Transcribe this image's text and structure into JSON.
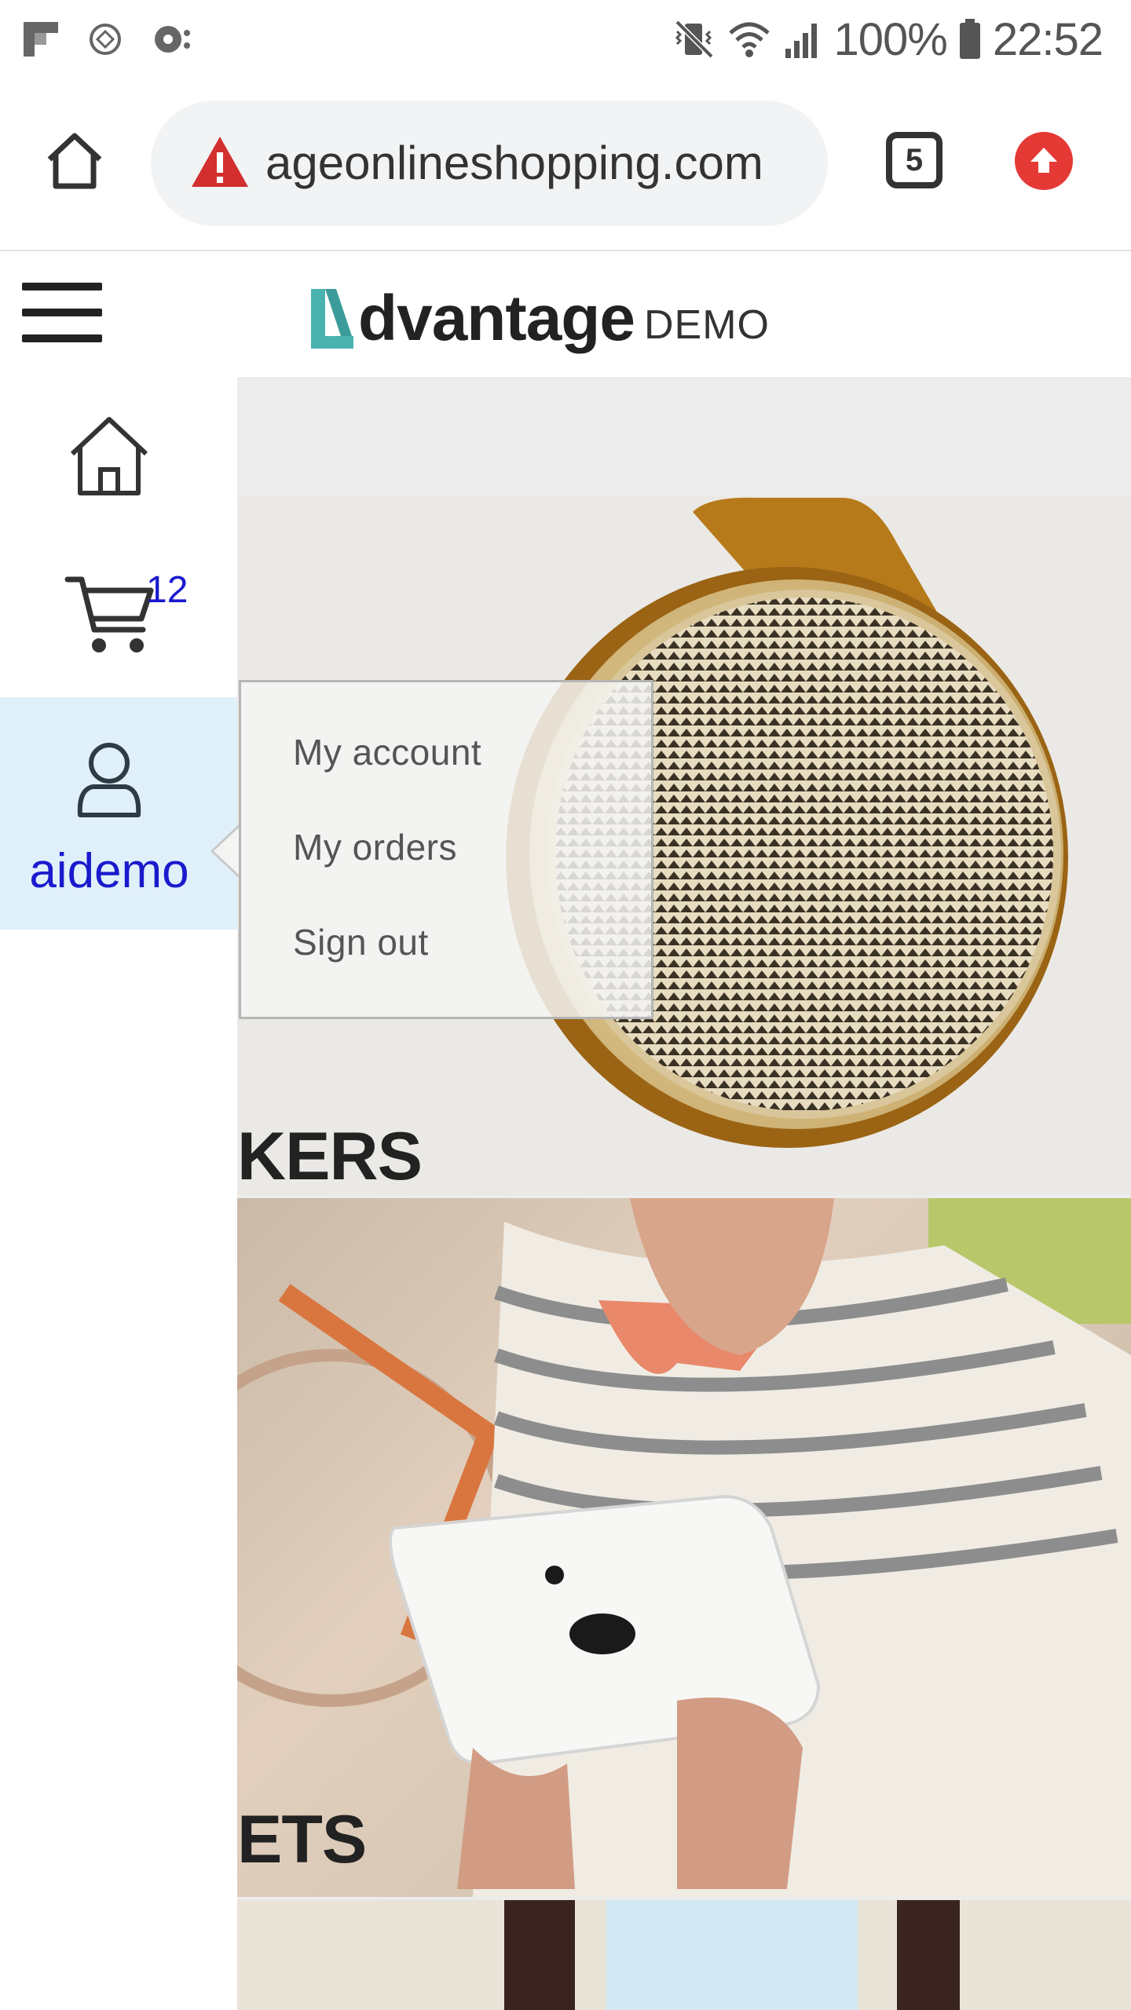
{
  "status_bar": {
    "battery": "100%",
    "time": "22:52",
    "icons": [
      "flipboard-icon",
      "app-icon",
      "podcast-icon",
      "vibrate-mute-icon",
      "wifi-icon",
      "signal-icon",
      "battery-icon"
    ]
  },
  "browser": {
    "url": "ageonlineshopping.com",
    "tab_count": "5",
    "icons": [
      "home-icon",
      "warning-icon",
      "tabs-icon",
      "update-icon"
    ]
  },
  "site": {
    "logo_main": "dvantage",
    "logo_suffix": "DEMO"
  },
  "sidenav": {
    "cart_count": "12",
    "user_name": "aidemo"
  },
  "user_menu": {
    "items": [
      "My account",
      "My orders",
      "Sign out"
    ]
  },
  "categories": {
    "speakers_title": "KERS",
    "tablets_title": "ETS"
  },
  "colors": {
    "accent_teal": "#4ab3b0",
    "link_blue": "#1a1acd",
    "update_red": "#e53935",
    "active_nav_bg": "#e0f0fa"
  }
}
